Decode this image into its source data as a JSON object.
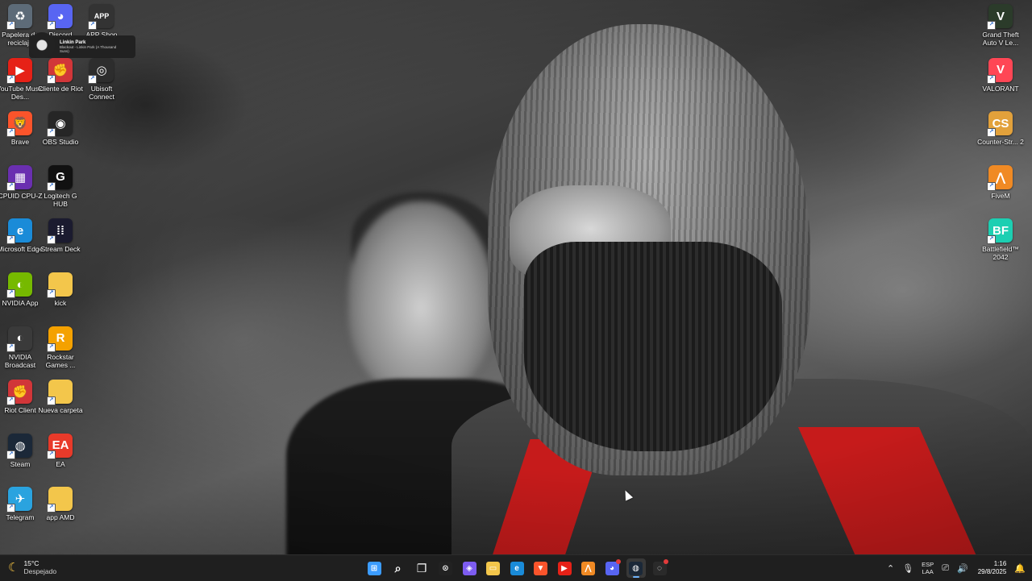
{
  "desktop": {
    "icons_left": [
      {
        "label": "Papelera de reciclaje",
        "icon": "recycle-bin-icon",
        "glyph": "♻",
        "color": "#5d6b78"
      },
      {
        "label": "Discord",
        "icon": "discord-icon",
        "glyph": "◕",
        "color": "#5865f2"
      },
      {
        "label": "APP Shop",
        "icon": "app-shop-icon",
        "glyph": "APP",
        "color": "#333333"
      },
      {
        "label": "YouTube Music Des...",
        "icon": "youtube-music-icon",
        "glyph": "▶",
        "color": "#e62117"
      },
      {
        "label": "Cliente de Riot",
        "icon": "riot-client-icon",
        "glyph": "✊",
        "color": "#d13639"
      },
      {
        "label": "Ubisoft Connect",
        "icon": "ubisoft-icon",
        "glyph": "◎",
        "color": "#2d2d2d"
      },
      {
        "label": "Brave",
        "icon": "brave-icon",
        "glyph": "🦁",
        "color": "#fb542b"
      },
      {
        "label": "OBS Studio",
        "icon": "obs-icon",
        "glyph": "◉",
        "color": "#262626"
      },
      {
        "label": "CPUID CPU-Z",
        "icon": "cpuz-icon",
        "glyph": "▦",
        "color": "#6a2fb0"
      },
      {
        "label": "Logitech G HUB",
        "icon": "logitech-icon",
        "glyph": "G",
        "color": "#111111"
      },
      {
        "label": "Microsoft Edge",
        "icon": "edge-icon",
        "glyph": "e",
        "color": "#1a8bd8"
      },
      {
        "label": "Stream Deck",
        "icon": "stream-deck-icon",
        "glyph": "⁞⁞",
        "color": "#1b1b2f"
      },
      {
        "label": "NVIDIA App",
        "icon": "nvidia-app-icon",
        "glyph": "◐",
        "color": "#76b900"
      },
      {
        "label": "kick",
        "icon": "folder-icon",
        "glyph": "",
        "color": "#f3c64b"
      },
      {
        "label": "NVIDIA Broadcast",
        "icon": "nvidia-broadcast-icon",
        "glyph": "◐",
        "color": "#3a3a3a"
      },
      {
        "label": "Rockstar Games ...",
        "icon": "rockstar-icon",
        "glyph": "R",
        "color": "#f4a100"
      },
      {
        "label": "Riot Client",
        "icon": "riot-client-icon",
        "glyph": "✊",
        "color": "#d13639"
      },
      {
        "label": "Nueva carpeta",
        "icon": "folder-icon",
        "glyph": "",
        "color": "#f3c64b"
      },
      {
        "label": "Steam",
        "icon": "steam-icon",
        "glyph": "◍",
        "color": "#1b2838"
      },
      {
        "label": "EA",
        "icon": "ea-icon",
        "glyph": "EA",
        "color": "#e83a2a"
      },
      {
        "label": "Telegram",
        "icon": "telegram-icon",
        "glyph": "✈",
        "color": "#2aa3df"
      },
      {
        "label": "app AMD",
        "icon": "folder-icon",
        "glyph": "",
        "color": "#f3c64b"
      }
    ],
    "icons_right": [
      {
        "label": "Grand Theft Auto V Le...",
        "icon": "gta-icon",
        "glyph": "V",
        "color": "#2b3b2a"
      },
      {
        "label": "VALORANT",
        "icon": "valorant-icon",
        "glyph": "V",
        "color": "#ff4655"
      },
      {
        "label": "Counter-Str... 2",
        "icon": "cs2-icon",
        "glyph": "CS",
        "color": "#e2a13b"
      },
      {
        "label": "FiveM",
        "icon": "fivem-icon",
        "glyph": "⋀",
        "color": "#f08a24"
      },
      {
        "label": "Battlefield™ 2042",
        "icon": "battlefield-icon",
        "glyph": "BF",
        "color": "#1ccfb2"
      }
    ]
  },
  "tooltip": {
    "title": "Linkin Park",
    "subtitle": "Blackout - Linkin Park (A Thousand Suns)"
  },
  "taskbar": {
    "weather": {
      "temp": "15°C",
      "condition": "Despejado"
    },
    "pinned": [
      {
        "name": "start-button",
        "icon": "windows-icon",
        "glyph": "⊞",
        "color": "#3b9cff",
        "active": false
      },
      {
        "name": "search-button",
        "icon": "search-icon",
        "glyph": "⌕",
        "color": "transparent",
        "active": false
      },
      {
        "name": "task-view-button",
        "icon": "task-view-icon",
        "glyph": "❐",
        "color": "transparent",
        "active": false
      },
      {
        "name": "taskbar-app-1",
        "icon": "app-icon",
        "glyph": "⊙",
        "color": "#222222",
        "active": false
      },
      {
        "name": "taskbar-copilot",
        "icon": "copilot-icon",
        "glyph": "◈",
        "color": "#7d5cf0",
        "active": false
      },
      {
        "name": "taskbar-file-explorer",
        "icon": "folder-icon",
        "glyph": "▭",
        "color": "#f3c64b",
        "active": false
      },
      {
        "name": "taskbar-edge",
        "icon": "edge-icon",
        "glyph": "e",
        "color": "#1a8bd8",
        "active": false
      },
      {
        "name": "taskbar-brave",
        "icon": "brave-icon",
        "glyph": "▼",
        "color": "#fb542b",
        "active": false
      },
      {
        "name": "taskbar-youtube-music",
        "icon": "youtube-music-icon",
        "glyph": "▶",
        "color": "#e62117",
        "active": false
      },
      {
        "name": "taskbar-fivem",
        "icon": "fivem-icon",
        "glyph": "⋀",
        "color": "#f08a24",
        "active": false
      },
      {
        "name": "taskbar-discord",
        "icon": "discord-icon",
        "glyph": "◕",
        "color": "#5865f2",
        "active": false,
        "badge": true
      },
      {
        "name": "taskbar-steam",
        "icon": "steam-icon",
        "glyph": "◍",
        "color": "#1b2838",
        "active": true
      },
      {
        "name": "taskbar-app-2",
        "icon": "app-icon",
        "glyph": "◌",
        "color": "#2a2a2a",
        "active": false,
        "badge": true
      }
    ],
    "tray": {
      "lang_top": "ESP",
      "lang_bottom": "LAA",
      "time": "1:16",
      "date": "29/8/2025"
    }
  }
}
